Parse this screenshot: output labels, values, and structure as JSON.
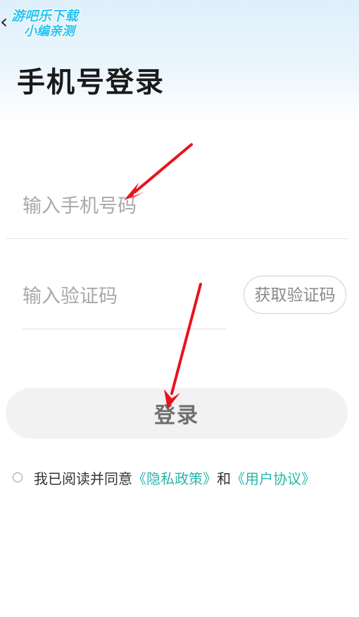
{
  "watermark": {
    "line1": "游吧乐下载",
    "line2": "小编亲测"
  },
  "header": {
    "back_icon": "chevron-left-icon",
    "title": "手机号登录"
  },
  "form": {
    "phone_placeholder": "输入手机号码",
    "phone_value": "",
    "code_placeholder": "输入验证码",
    "code_value": "",
    "get_code_label": "获取验证码",
    "login_label": "登录"
  },
  "agreement": {
    "checked": false,
    "prefix": "我已阅读并同意",
    "privacy_link": "《隐私政策》",
    "conjunction": "和",
    "terms_link": "《用户协议》"
  },
  "colors": {
    "link": "#2bb5ad",
    "annotation_arrow": "#e8141c",
    "header_gradient_top": "#dff0fb",
    "watermark": "#27c3f0"
  }
}
